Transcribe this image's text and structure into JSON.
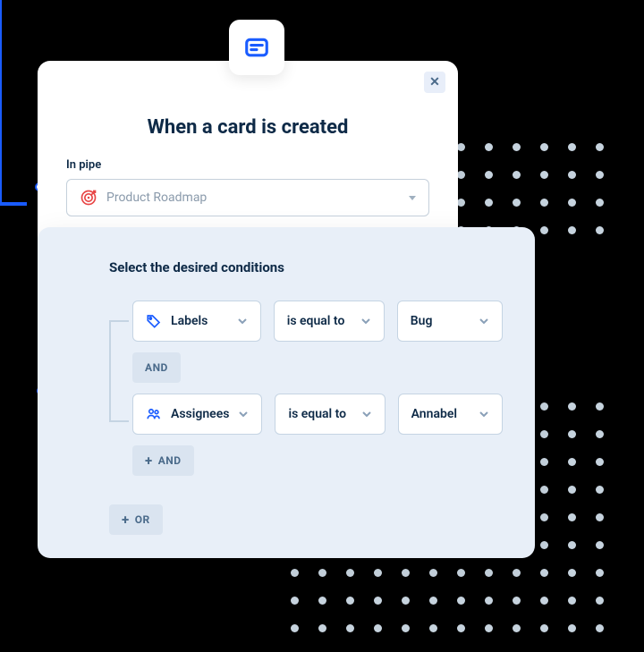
{
  "trigger": {
    "title": "When a card is created",
    "pipe_label": "In pipe",
    "pipe_value": "Product Roadmap"
  },
  "conditions": {
    "title": "Select the desired conditions",
    "rows": [
      {
        "field": "Labels",
        "operator": "is equal to",
        "value": "Bug"
      },
      {
        "field": "Assignees",
        "operator": "is equal to",
        "value": "Annabel"
      }
    ],
    "and_label": "AND",
    "add_and_label": "AND",
    "add_or_label": "OR"
  }
}
